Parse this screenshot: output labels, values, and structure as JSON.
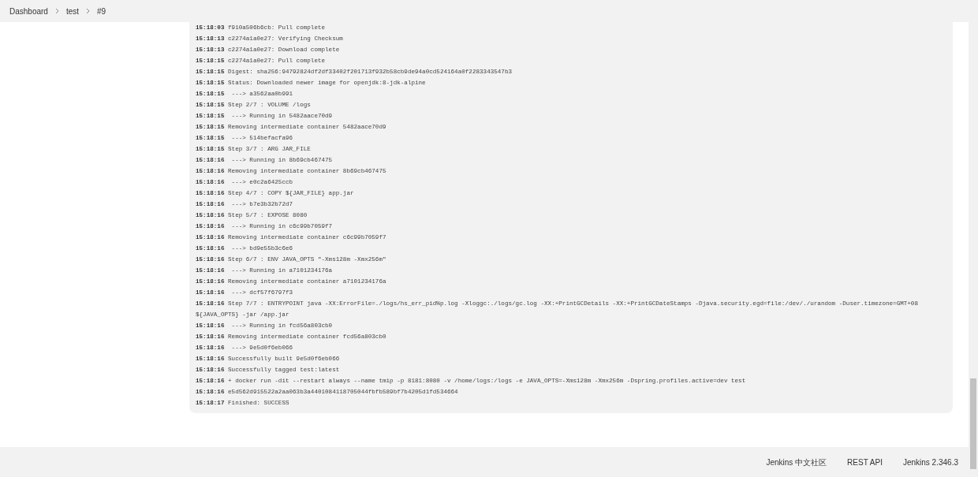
{
  "breadcrumbs": [
    {
      "label": "Dashboard"
    },
    {
      "label": "test"
    },
    {
      "label": "#9"
    }
  ],
  "console_log": [
    {
      "time": "15:18:03",
      "text": "f910a506b6cb: Pull complete"
    },
    {
      "time": "15:18:13",
      "text": "c2274a1a0e27: Verifying Checksum"
    },
    {
      "time": "15:18:13",
      "text": "c2274a1a0e27: Download complete"
    },
    {
      "time": "15:18:15",
      "text": "c2274a1a0e27: Pull complete"
    },
    {
      "time": "15:18:15",
      "text": "Digest: sha256:94792824df2df33402f201713f932b58cb9de94a0cd524164a0f2283343547b3"
    },
    {
      "time": "15:18:15",
      "text": "Status: Downloaded newer image for openjdk:8-jdk-alpine"
    },
    {
      "time": "15:18:15",
      "text": " ---> a3562aa0b991"
    },
    {
      "time": "15:18:15",
      "text": "Step 2/7 : VOLUME /logs"
    },
    {
      "time": "15:18:15",
      "text": " ---> Running in 5482aace70d9"
    },
    {
      "time": "15:18:15",
      "text": "Removing intermediate container 5482aace70d9"
    },
    {
      "time": "15:18:15",
      "text": " ---> 514befacfa96"
    },
    {
      "time": "15:18:15",
      "text": "Step 3/7 : ARG JAR_FILE"
    },
    {
      "time": "15:18:16",
      "text": " ---> Running in 8b69cb467475"
    },
    {
      "time": "15:18:16",
      "text": "Removing intermediate container 8b69cb467475"
    },
    {
      "time": "15:18:16",
      "text": " ---> e0c2a6425ccb"
    },
    {
      "time": "15:18:16",
      "text": "Step 4/7 : COPY ${JAR_FILE} app.jar"
    },
    {
      "time": "15:18:16",
      "text": " ---> b7e3b32b72d7"
    },
    {
      "time": "15:18:16",
      "text": "Step 5/7 : EXPOSE 8080"
    },
    {
      "time": "15:18:16",
      "text": " ---> Running in c6c99b7059f7"
    },
    {
      "time": "15:18:16",
      "text": "Removing intermediate container c6c99b7059f7"
    },
    {
      "time": "15:18:16",
      "text": " ---> bd9e55b3c6e6"
    },
    {
      "time": "15:18:16",
      "text": "Step 6/7 : ENV JAVA_OPTS \"-Xms128m -Xmx256m\""
    },
    {
      "time": "15:18:16",
      "text": " ---> Running in a7101234176a"
    },
    {
      "time": "15:18:16",
      "text": "Removing intermediate container a7101234176a"
    },
    {
      "time": "15:18:16",
      "text": " ---> dcf57f6797f3"
    },
    {
      "time": "15:18:16",
      "text": "Step 7/7 : ENTRYPOINT java -XX:ErrorFile=./logs/hs_err_pid%p.log -Xloggc:./logs/gc.log -XX:+PrintGCDetails -XX:+PrintGCDateStamps -Djava.security.egd=file:/dev/./urandom -Duser.timezone=GMT+08 ${JAVA_OPTS} -jar /app.jar"
    },
    {
      "time": "15:18:16",
      "text": " ---> Running in fcd56a803cb0"
    },
    {
      "time": "15:18:16",
      "text": "Removing intermediate container fcd56a803cb0"
    },
    {
      "time": "15:18:16",
      "text": " ---> 9e5d0f6eb066"
    },
    {
      "time": "15:18:16",
      "text": "Successfully built 9e5d0f6eb066"
    },
    {
      "time": "15:18:16",
      "text": "Successfully tagged test:latest"
    },
    {
      "time": "15:18:16",
      "text": "+ docker run -dit --restart always --name tmip -p 8181:8080 -v /home/logs:/logs -e JAVA_OPTS=-Xms128m -Xmx256m -Dspring.profiles.active=dev test"
    },
    {
      "time": "15:18:16",
      "text": "e5d562d915522a2aa063b3a4401084118705044fbfb589bf7b4205d1fd534664"
    },
    {
      "time": "15:18:17",
      "text": "Finished: SUCCESS"
    }
  ],
  "footer": {
    "links": [
      "Jenkins 中文社区",
      "REST API",
      "Jenkins 2.346.3"
    ]
  }
}
